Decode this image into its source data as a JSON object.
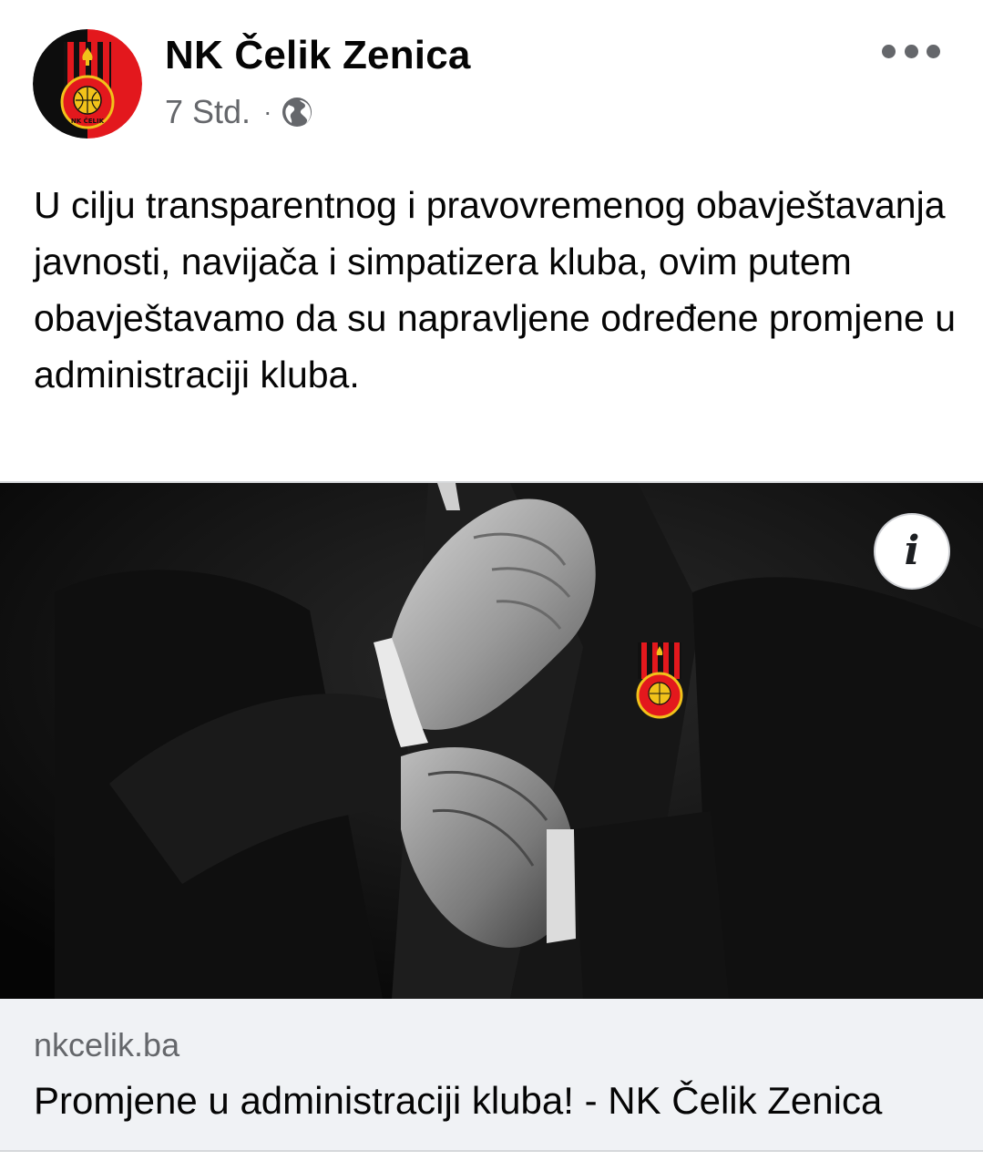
{
  "post": {
    "author": "NK Čelik Zenica",
    "time": "7 Std.",
    "separator": "·",
    "privacy_icon": "globe-icon",
    "more_icon": "more-options-icon",
    "text": "U cilju transparentnog i pravovremenog obavještavanja javnosti, navijača i simpatizera kluba, ovim putem obavještavamo da su napravljene određene promjene u administraciji kluba."
  },
  "link_preview": {
    "info_icon": "info-icon",
    "info_label": "i",
    "domain": "nkcelik.ba",
    "title": "Promjene u administraciji kluba! - NK Čelik Zenica"
  },
  "colors": {
    "club_red": "#e3181d",
    "club_black": "#111111",
    "ball_yellow": "#f1c21a",
    "meta_grey": "#65676b",
    "card_bg": "#f0f2f5"
  }
}
